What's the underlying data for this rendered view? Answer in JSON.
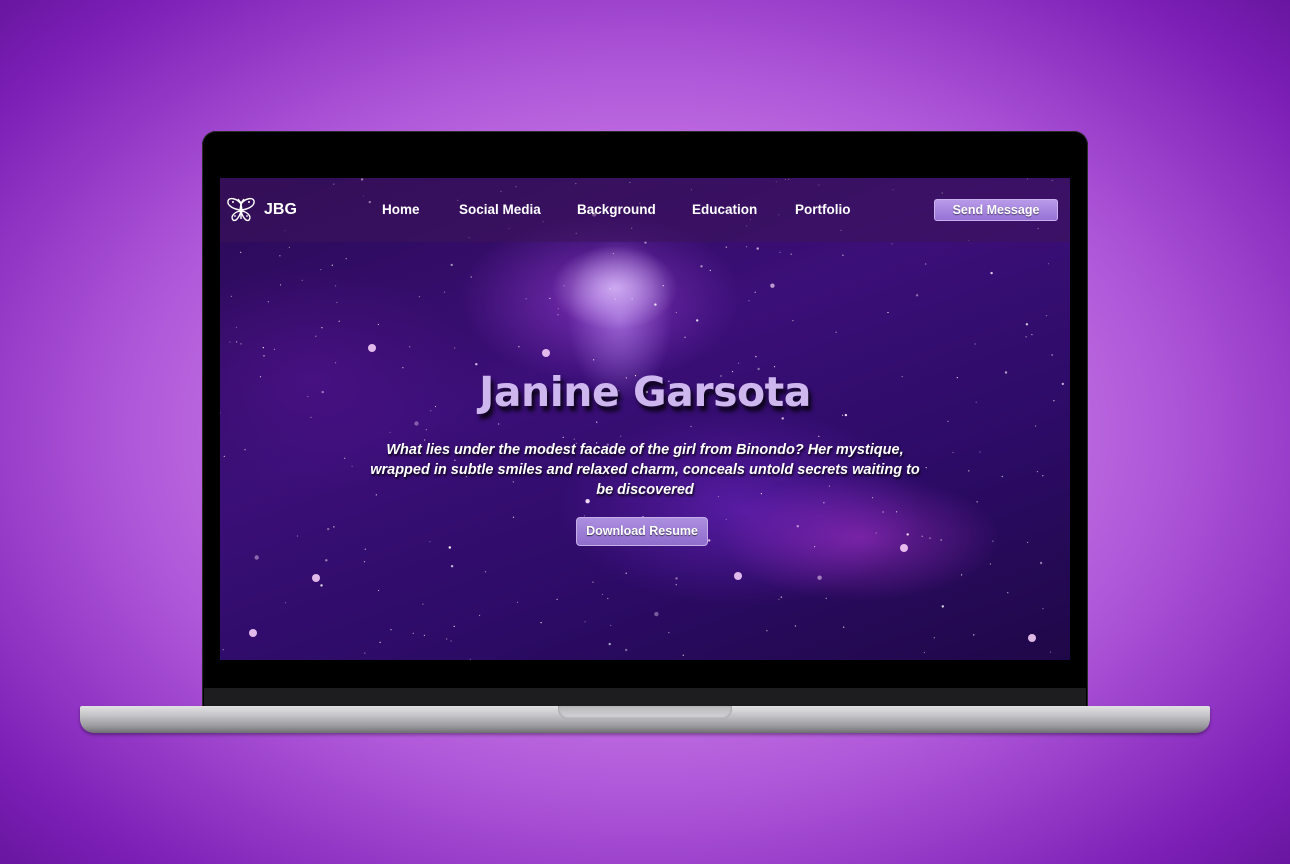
{
  "brand": {
    "name": "JBG",
    "logo_icon": "butterfly-icon"
  },
  "nav": {
    "links": [
      {
        "label": "Home"
      },
      {
        "label": "Social Media"
      },
      {
        "label": "Background"
      },
      {
        "label": "Education"
      },
      {
        "label": "Portfolio"
      }
    ],
    "cta_label": "Send Message"
  },
  "hero": {
    "title": "Janine Garsota",
    "description": "What lies under the modest facade of the girl from Binondo? Her mystique, wrapped in subtle smiles and relaxed charm, conceals untold secrets waiting to be discovered",
    "button_label": "Download Resume"
  },
  "colors": {
    "page_background": "#c26fe3",
    "accent_button": "#9672d6",
    "title_text": "#cdb7ee",
    "nav_text": "#ffffff"
  }
}
